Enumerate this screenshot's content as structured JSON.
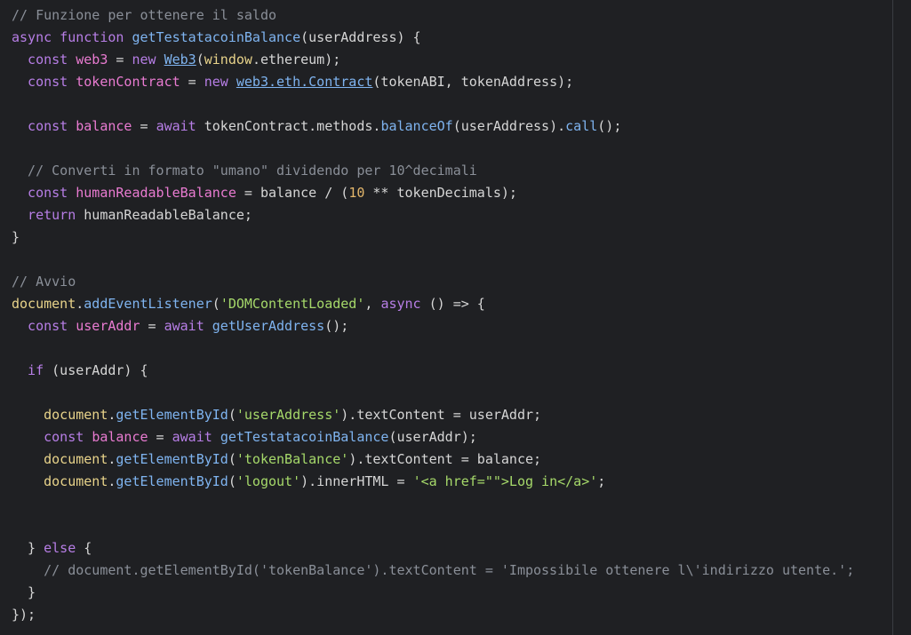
{
  "editor": {
    "lines": [
      [
        {
          "t": "// Funzione per ottenere il saldo",
          "c": "cm"
        }
      ],
      [
        {
          "t": "async function ",
          "c": "kw"
        },
        {
          "t": "getTestatacoinBalance",
          "c": "fn"
        },
        {
          "t": "(userAddress) {",
          "c": "op"
        }
      ],
      [
        {
          "t": "  const ",
          "c": "kw"
        },
        {
          "t": "web3",
          "c": "vr"
        },
        {
          "t": " = ",
          "c": "op"
        },
        {
          "t": "new ",
          "c": "kw"
        },
        {
          "t": "Web3",
          "c": "fn ul"
        },
        {
          "t": "(",
          "c": "op"
        },
        {
          "t": "window",
          "c": "ob"
        },
        {
          "t": ".ethereum);",
          "c": "op"
        }
      ],
      [
        {
          "t": "  const ",
          "c": "kw"
        },
        {
          "t": "tokenContract",
          "c": "vr"
        },
        {
          "t": " = ",
          "c": "op"
        },
        {
          "t": "new ",
          "c": "kw"
        },
        {
          "t": "web3.eth.Contract",
          "c": "fn ul"
        },
        {
          "t": "(tokenABI, tokenAddress);",
          "c": "op"
        }
      ],
      [],
      [
        {
          "t": "  const ",
          "c": "kw"
        },
        {
          "t": "balance",
          "c": "vr"
        },
        {
          "t": " = ",
          "c": "op"
        },
        {
          "t": "await ",
          "c": "kw"
        },
        {
          "t": "tokenContract.methods.",
          "c": "op"
        },
        {
          "t": "balanceOf",
          "c": "fn"
        },
        {
          "t": "(userAddress).",
          "c": "op"
        },
        {
          "t": "call",
          "c": "fn"
        },
        {
          "t": "();",
          "c": "op"
        }
      ],
      [],
      [
        {
          "t": "  // Converti in formato \"umano\" dividendo per 10^decimali",
          "c": "cm"
        }
      ],
      [
        {
          "t": "  const ",
          "c": "kw"
        },
        {
          "t": "humanReadableBalance",
          "c": "vr"
        },
        {
          "t": " = balance / (",
          "c": "op"
        },
        {
          "t": "10",
          "c": "nm"
        },
        {
          "t": " ** tokenDecimals);",
          "c": "op"
        }
      ],
      [
        {
          "t": "  return ",
          "c": "kw"
        },
        {
          "t": "humanReadableBalance;",
          "c": "op"
        }
      ],
      [
        {
          "t": "}",
          "c": "op"
        }
      ],
      [],
      [
        {
          "t": "// Avvio",
          "c": "cm"
        }
      ],
      [
        {
          "t": "document",
          "c": "ob"
        },
        {
          "t": ".",
          "c": "op"
        },
        {
          "t": "addEventListener",
          "c": "fn"
        },
        {
          "t": "(",
          "c": "op"
        },
        {
          "t": "'DOMContentLoaded'",
          "c": "st"
        },
        {
          "t": ", ",
          "c": "op"
        },
        {
          "t": "async ",
          "c": "kw"
        },
        {
          "t": "() => {",
          "c": "op"
        }
      ],
      [
        {
          "t": "  const ",
          "c": "kw"
        },
        {
          "t": "userAddr",
          "c": "vr"
        },
        {
          "t": " = ",
          "c": "op"
        },
        {
          "t": "await ",
          "c": "kw"
        },
        {
          "t": "getUserAddress",
          "c": "fn"
        },
        {
          "t": "();",
          "c": "op"
        }
      ],
      [],
      [
        {
          "t": "  if ",
          "c": "kw"
        },
        {
          "t": "(userAddr) {",
          "c": "op"
        }
      ],
      [],
      [
        {
          "t": "    document",
          "c": "ob"
        },
        {
          "t": ".",
          "c": "op"
        },
        {
          "t": "getElementById",
          "c": "fn"
        },
        {
          "t": "(",
          "c": "op"
        },
        {
          "t": "'userAddress'",
          "c": "st"
        },
        {
          "t": ").textContent = userAddr;",
          "c": "op"
        }
      ],
      [
        {
          "t": "    const ",
          "c": "kw"
        },
        {
          "t": "balance",
          "c": "vr"
        },
        {
          "t": " = ",
          "c": "op"
        },
        {
          "t": "await ",
          "c": "kw"
        },
        {
          "t": "getTestatacoinBalance",
          "c": "fn"
        },
        {
          "t": "(userAddr);",
          "c": "op"
        }
      ],
      [
        {
          "t": "    document",
          "c": "ob"
        },
        {
          "t": ".",
          "c": "op"
        },
        {
          "t": "getElementById",
          "c": "fn"
        },
        {
          "t": "(",
          "c": "op"
        },
        {
          "t": "'tokenBalance'",
          "c": "st"
        },
        {
          "t": ").textContent = balance;",
          "c": "op"
        }
      ],
      [
        {
          "t": "    document",
          "c": "ob"
        },
        {
          "t": ".",
          "c": "op"
        },
        {
          "t": "getElementById",
          "c": "fn"
        },
        {
          "t": "(",
          "c": "op"
        },
        {
          "t": "'logout'",
          "c": "st"
        },
        {
          "t": ").innerHTML = ",
          "c": "op"
        },
        {
          "t": "'<a href=\"\">Log in</a>'",
          "c": "st"
        },
        {
          "t": ";",
          "c": "op"
        }
      ],
      [],
      [],
      [
        {
          "t": "  } ",
          "c": "op"
        },
        {
          "t": "else ",
          "c": "kw"
        },
        {
          "t": "{",
          "c": "op"
        }
      ],
      [
        {
          "t": "    // document.getElementById('tokenBalance').textContent = 'Impossibile ottenere l\\'indirizzo utente.';",
          "c": "cm"
        }
      ],
      [
        {
          "t": "  }",
          "c": "op"
        }
      ],
      [
        {
          "t": "});",
          "c": "op"
        }
      ]
    ]
  }
}
